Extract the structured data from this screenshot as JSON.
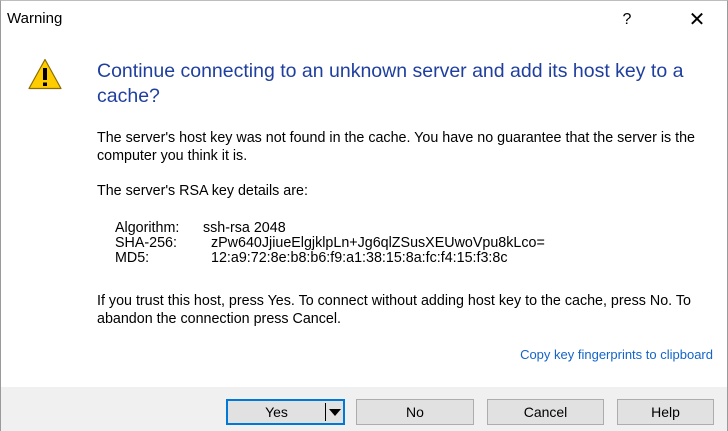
{
  "window": {
    "title": "Warning",
    "help_glyph": "?",
    "close_glyph": "✕"
  },
  "icons": {
    "warning": "warning-triangle-icon"
  },
  "message": {
    "heading": "Continue connecting to an unknown server and add its host key to a cache?",
    "paragraph1": "The server's host key was not found in the cache. You have no guarantee that the server is the computer you think it is.",
    "paragraph2": "The server's RSA key details are:",
    "key_details": [
      {
        "label": "Algorithm:",
        "value": "ssh-rsa 2048"
      },
      {
        "label": "SHA-256:",
        "value": "zPw640JjiueElgjklpLn+Jg6qlZSusXEUwoVpu8kLco="
      },
      {
        "label": "MD5:",
        "value": "12:a9:72:8e:b8:b6:f9:a1:38:15:8a:fc:f4:15:f3:8c"
      }
    ],
    "paragraph3": "If you trust this host, press Yes. To connect without adding host key to the cache, press No. To abandon the connection press Cancel."
  },
  "copy_link": "Copy key fingerprints to clipboard",
  "buttons": {
    "yes": "Yes",
    "no": "No",
    "cancel": "Cancel",
    "help": "Help"
  },
  "colors": {
    "heading": "#1f3f9e",
    "link": "#1464c8",
    "focus_border": "#0078d7",
    "warning_fill": "#ffcc00"
  }
}
